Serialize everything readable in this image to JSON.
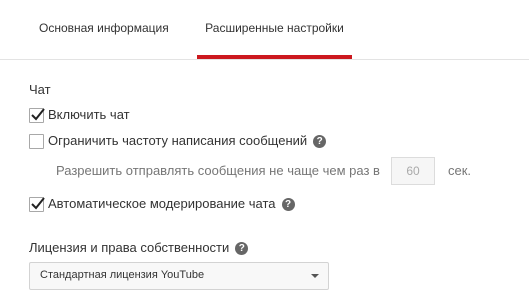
{
  "tabs": [
    {
      "label": "Основная информация",
      "active": false
    },
    {
      "label": "Расширенные настройки",
      "active": true
    }
  ],
  "accent_color": "#cc181e",
  "chat": {
    "section_title": "Чат",
    "enable_chat": {
      "label": "Включить чат",
      "checked": true
    },
    "limit_rate": {
      "label": "Ограничить частоту написания сообщений",
      "checked": false,
      "help_icon": "?"
    },
    "rate_text": "Разрешить отправлять сообщения не чаще чем раз в",
    "rate_value": "60",
    "rate_unit": "сек.",
    "auto_moderation": {
      "label": "Автоматическое модерирование чата",
      "checked": true,
      "help_icon": "?"
    }
  },
  "license": {
    "section_title": "Лицензия и права собственности",
    "help_icon": "?",
    "selected": "Стандартная лицензия YouTube"
  }
}
